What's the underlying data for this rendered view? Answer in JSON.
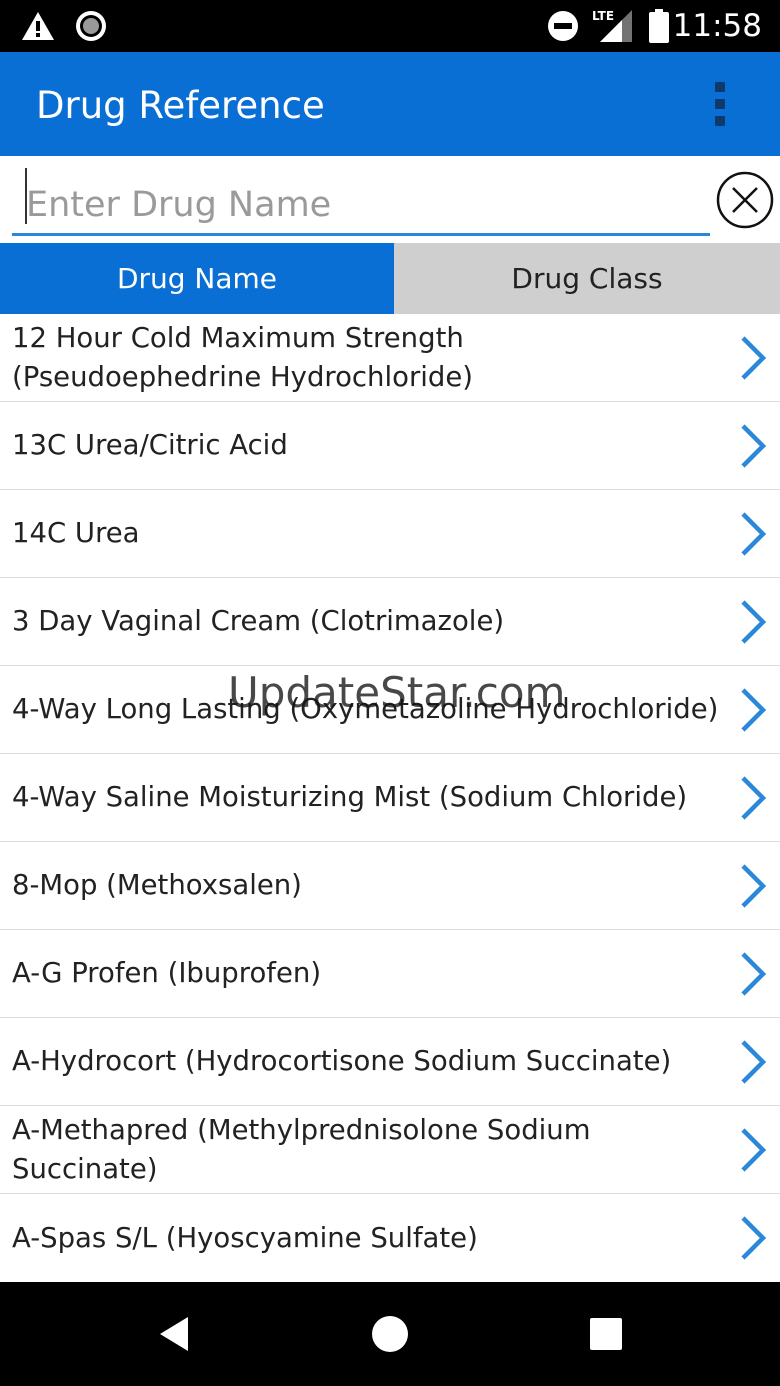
{
  "status_bar": {
    "time": "11:58",
    "network": "LTE",
    "icons": [
      "warning-icon",
      "record-icon",
      "do-not-disturb-icon",
      "lte-signal-icon",
      "battery-icon"
    ]
  },
  "app_bar": {
    "title": "Drug Reference",
    "menu_icon": "overflow-menu-icon"
  },
  "search": {
    "placeholder": "Enter Drug Name",
    "value": "",
    "clear_icon": "clear-circle-icon"
  },
  "tabs": [
    {
      "label": "Drug Name",
      "active": true
    },
    {
      "label": "Drug Class",
      "active": false
    }
  ],
  "drugs": [
    {
      "name": "12 Hour Cold Maximum Strength (Pseudoephedrine Hydrochloride)"
    },
    {
      "name": "13C Urea/Citric Acid"
    },
    {
      "name": "14C Urea"
    },
    {
      "name": "3 Day Vaginal Cream (Clotrimazole)"
    },
    {
      "name": "4-Way Long Lasting (Oxymetazoline Hydrochloride)"
    },
    {
      "name": "4-Way Saline Moisturizing Mist (Sodium Chloride)"
    },
    {
      "name": "8-Mop (Methoxsalen)"
    },
    {
      "name": "A-G Profen (Ibuprofen)"
    },
    {
      "name": "A-Hydrocort (Hydrocortisone Sodium Succinate)"
    },
    {
      "name": "A-Methapred (Methylprednisolone Sodium Succinate)"
    },
    {
      "name": "A-Spas S/L (Hyoscyamine Sulfate)"
    }
  ],
  "watermark": "UpdateStar.com",
  "colors": {
    "primary": "#0a6fd4",
    "chevron": "#2b87d8",
    "tab_inactive": "#cfcfcf"
  }
}
